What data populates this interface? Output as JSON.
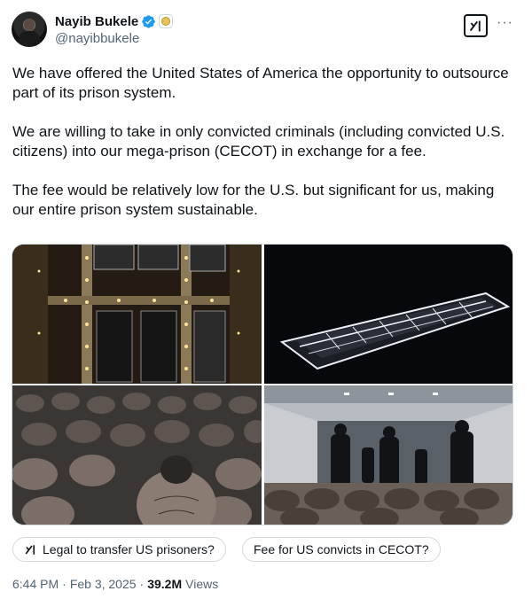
{
  "author": {
    "display_name": "Nayib Bukele",
    "handle": "@nayibbukele"
  },
  "icons": {
    "verified": "verified-badge-icon",
    "affiliation": "government-seal-icon",
    "grok": "grok-icon",
    "more": "more-options-icon"
  },
  "colors": {
    "verified_blue": "#1d9bf0",
    "text_primary": "#0f1419",
    "text_secondary": "#536471",
    "border": "#cfd9de"
  },
  "post": {
    "paragraphs": [
      "We have offered the United States of America the opportunity to outsource part of its prison system.",
      "We are willing to take in only convicted criminals (including convicted U.S. citizens) into our mega-prison (CECOT) in exchange for a fee.",
      "The fee would be relatively low for the U.S. but significant for us, making our entire prison system sustainable."
    ]
  },
  "suggestions": [
    {
      "label": "Legal to transfer US prisoners?"
    },
    {
      "label": "Fee for US convicts in CECOT?"
    }
  ],
  "meta": {
    "time": "6:44 PM",
    "separator": "·",
    "date": "Feb 3, 2025",
    "views_count": "39.2M",
    "views_label": "Views"
  }
}
